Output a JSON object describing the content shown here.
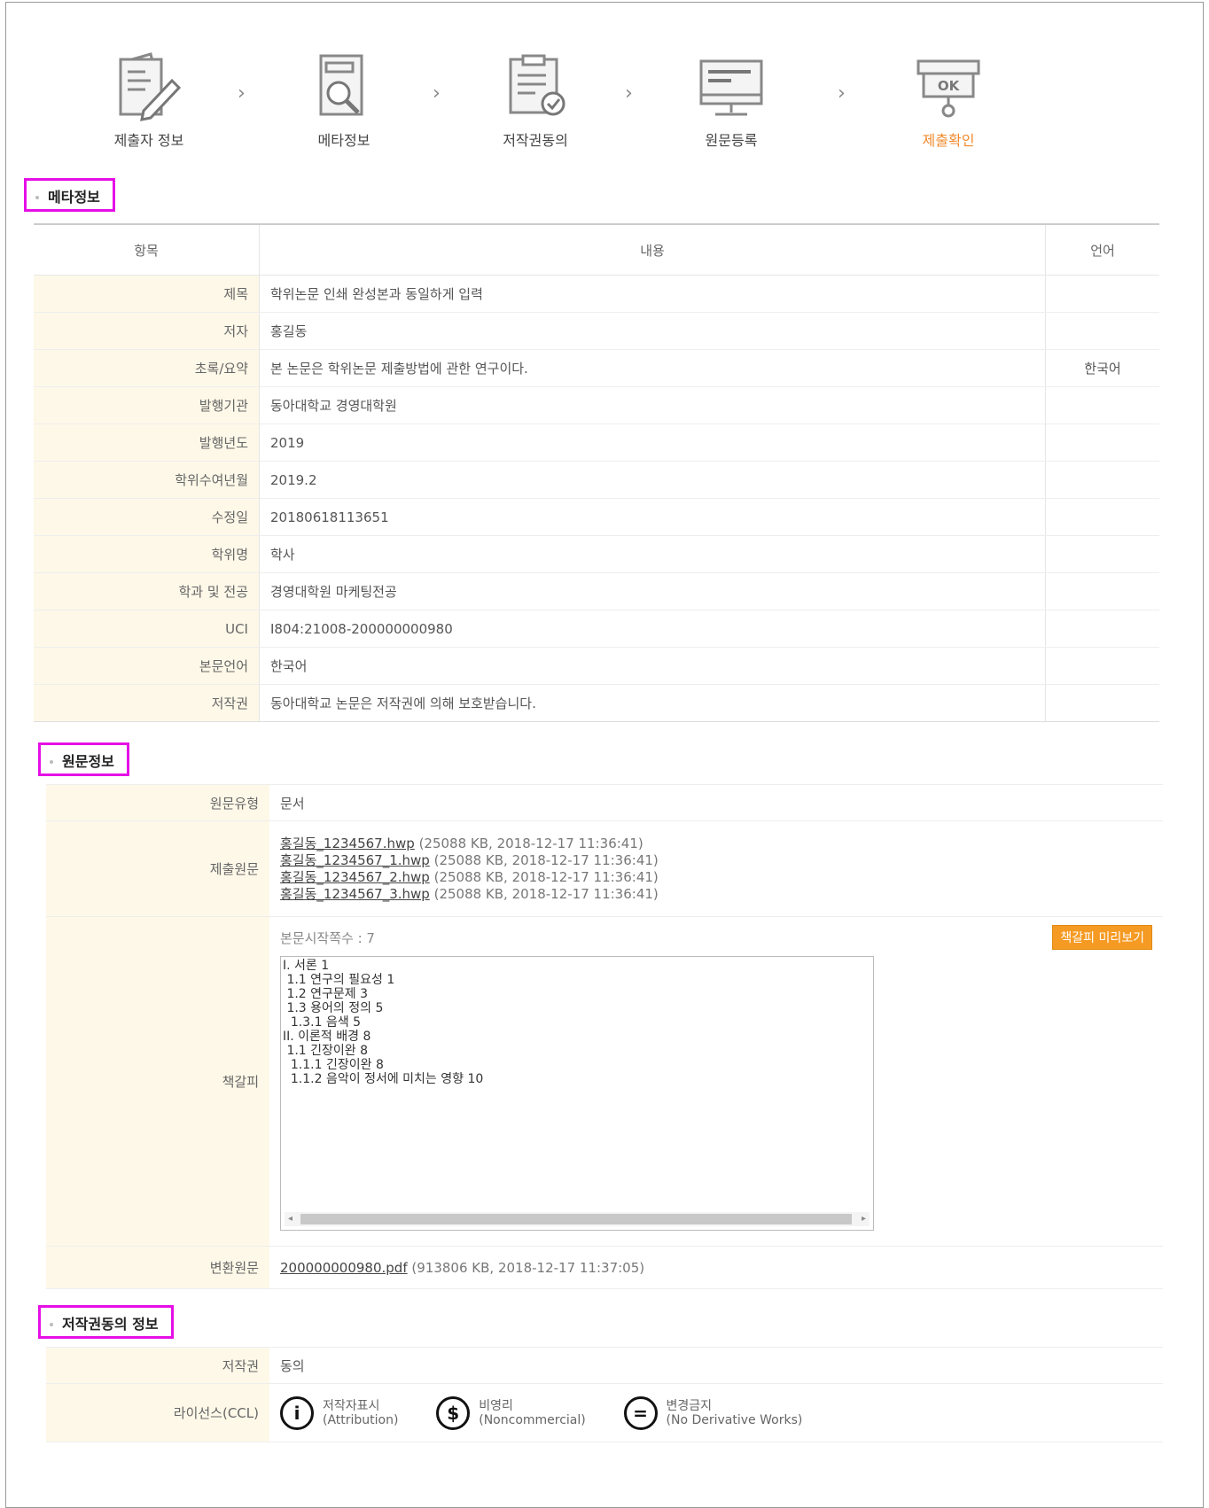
{
  "steps": [
    {
      "label": "제출자 정보",
      "icon": "document-pen-icon"
    },
    {
      "label": "메타정보",
      "icon": "document-search-icon"
    },
    {
      "label": "저작권동의",
      "icon": "document-check-icon"
    },
    {
      "label": "원문등록",
      "icon": "monitor-icon"
    },
    {
      "label": "제출확인",
      "icon": "ok-stamp-icon",
      "active": true
    }
  ],
  "colors": {
    "accent": "#f08a2c",
    "highlight_border": "#e60fe6",
    "key_bg": "#fdf8e8"
  },
  "meta_section": {
    "title": "메타정보",
    "headers": {
      "item": "항목",
      "content": "내용",
      "lang": "언어"
    },
    "rows": [
      {
        "key": "제목",
        "value": "학위논문 인쇄 완성본과 동일하게 입력",
        "lang": ""
      },
      {
        "key": "저자",
        "value": "홍길동",
        "lang": ""
      },
      {
        "key": "초록/요약",
        "value": "본 논문은 학위논문 제출방법에 관한 연구이다.",
        "lang": "한국어"
      },
      {
        "key": "발행기관",
        "value": "동아대학교 경영대학원",
        "lang": ""
      },
      {
        "key": "발행년도",
        "value": "2019",
        "lang": ""
      },
      {
        "key": "학위수여년월",
        "value": "2019.2",
        "lang": ""
      },
      {
        "key": "수정일",
        "value": "20180618113651",
        "lang": ""
      },
      {
        "key": "학위명",
        "value": "학사",
        "lang": ""
      },
      {
        "key": "학과 및 전공",
        "value": "경영대학원 마케팅전공",
        "lang": ""
      },
      {
        "key": "UCI",
        "value": "I804:21008-200000000980",
        "lang": ""
      },
      {
        "key": "본문언어",
        "value": "한국어",
        "lang": ""
      },
      {
        "key": "저작권",
        "value": "동아대학교 논문은 저작권에 의해 보호받습니다.",
        "lang": ""
      }
    ]
  },
  "original_section": {
    "title": "원문정보",
    "type_label": "원문유형",
    "type_value": "문서",
    "submitted_label": "제출원문",
    "files": [
      {
        "name": "홍길동_1234567.hwp",
        "meta": "(25088 KB, 2018-12-17 11:36:41)"
      },
      {
        "name": "홍길동_1234567_1.hwp",
        "meta": "(25088 KB, 2018-12-17 11:36:41)"
      },
      {
        "name": "홍길동_1234567_2.hwp",
        "meta": "(25088 KB, 2018-12-17 11:36:41)"
      },
      {
        "name": "홍길동_1234567_3.hwp",
        "meta": "(25088 KB, 2018-12-17 11:36:41)"
      }
    ],
    "bookmark_label": "책갈피",
    "start_page": "본문시작쪽수 : 7",
    "preview_button": "책갈피 미리보기",
    "bookmark_text": "I. 서론 1\n 1.1 연구의 필요성 1\n 1.2 연구문제 3\n 1.3 용어의 정의 5\n  1.3.1 음색 5\nII. 이론적 배경 8\n 1.1 긴장이완 8\n  1.1.1 긴장이완 8\n  1.1.2 음악이 정서에 미치는 영향 10",
    "converted_label": "변환원문",
    "converted_file": {
      "name": "200000000980.pdf",
      "meta": "(913806 KB, 2018-12-17 11:37:05)"
    }
  },
  "copyright_section": {
    "title": "저작권동의 정보",
    "copyright_label": "저작권",
    "copyright_value": "동의",
    "license_label": "라이선스(CCL)",
    "licenses": [
      {
        "name": "저작자표시",
        "en": "(Attribution)",
        "icon": "attribution-icon",
        "glyph": "i"
      },
      {
        "name": "비영리",
        "en": "(Noncommercial)",
        "icon": "noncommercial-icon",
        "glyph": "$"
      },
      {
        "name": "변경금지",
        "en": "(No Derivative Works)",
        "icon": "no-derivative-icon",
        "glyph": "="
      }
    ]
  }
}
